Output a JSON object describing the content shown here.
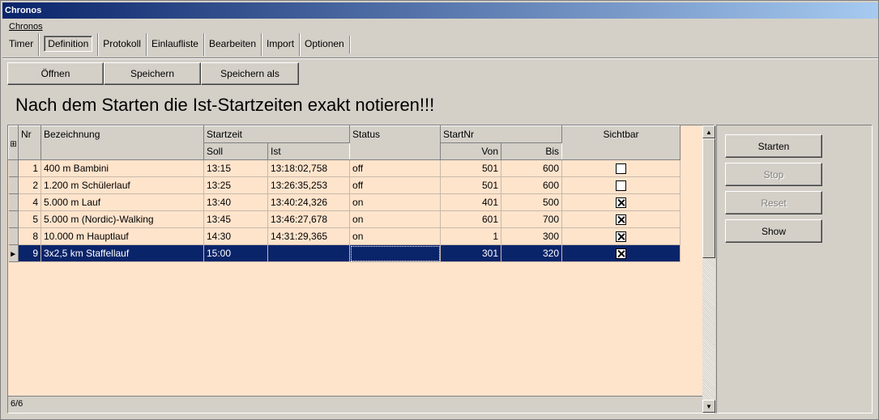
{
  "window": {
    "title": "Chronos"
  },
  "menu": {
    "items": [
      {
        "label": "Chronos"
      }
    ]
  },
  "tabs": [
    {
      "label": "Timer",
      "active": false
    },
    {
      "label": "Definition",
      "active": true
    },
    {
      "label": "Protokoll",
      "active": false
    },
    {
      "label": "Einlaufliste",
      "active": false
    },
    {
      "label": "Bearbeiten",
      "active": false
    },
    {
      "label": "Import",
      "active": false
    },
    {
      "label": "Optionen",
      "active": false
    }
  ],
  "toolbar": {
    "open_label": "Öffnen",
    "save_label": "Speichern",
    "save_as_label": "Speichern als"
  },
  "headline": "Nach dem Starten die Ist-Startzeiten exakt notieren!!!",
  "grid": {
    "headers": {
      "nr": "Nr",
      "bezeichnung": "Bezeichnung",
      "startzeit": "Startzeit",
      "soll": "Soll",
      "ist": "Ist",
      "status": "Status",
      "startnr": "StartNr",
      "von": "Von",
      "bis": "Bis",
      "sichtbar": "Sichtbar"
    },
    "rows": [
      {
        "nr": "1",
        "bezeichnung": "400 m Bambini",
        "soll": "13:15",
        "ist": "13:18:02,758",
        "status": "off",
        "von": "501",
        "bis": "600",
        "sichtbar": false,
        "selected": false
      },
      {
        "nr": "2",
        "bezeichnung": "1.200 m Schülerlauf",
        "soll": "13:25",
        "ist": "13:26:35,253",
        "status": "off",
        "von": "501",
        "bis": "600",
        "sichtbar": false,
        "selected": false
      },
      {
        "nr": "4",
        "bezeichnung": "5.000 m Lauf",
        "soll": "13:40",
        "ist": "13:40:24,326",
        "status": "on",
        "von": "401",
        "bis": "500",
        "sichtbar": true,
        "selected": false
      },
      {
        "nr": "5",
        "bezeichnung": "5.000 m (Nordic)-Walking",
        "soll": "13:45",
        "ist": "13:46:27,678",
        "status": "on",
        "von": "601",
        "bis": "700",
        "sichtbar": true,
        "selected": false
      },
      {
        "nr": "8",
        "bezeichnung": "10.000 m Hauptlauf",
        "soll": "14:30",
        "ist": "14:31:29,365",
        "status": "on",
        "von": "1",
        "bis": "300",
        "sichtbar": true,
        "selected": false
      },
      {
        "nr": "9",
        "bezeichnung": "3x2,5 km Staffellauf",
        "soll": "15:00",
        "ist": "",
        "status": "",
        "von": "301",
        "bis": "320",
        "sichtbar": true,
        "selected": true
      }
    ],
    "record_indicator": "6/6"
  },
  "side_buttons": {
    "start_label": "Starten",
    "stop_label": "Stop",
    "reset_label": "Reset",
    "show_label": "Show"
  },
  "colors": {
    "grid_background": "#ffe4cc",
    "selection": "#0a246a",
    "title_bar": "#0a246a"
  }
}
